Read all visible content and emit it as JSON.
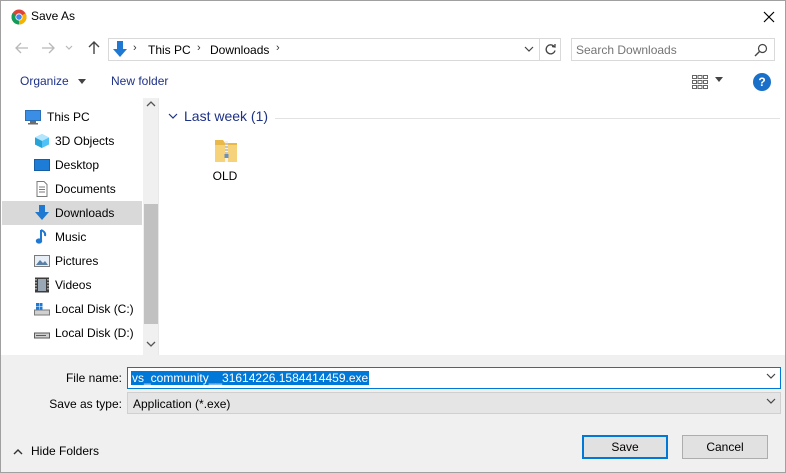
{
  "window": {
    "title": "Save As"
  },
  "address": {
    "crumbs": [
      "This PC",
      "Downloads"
    ],
    "search_placeholder": "Search Downloads"
  },
  "toolbar": {
    "organize_label": "Organize",
    "new_folder_label": "New folder",
    "help_label": "?"
  },
  "nav": {
    "items": [
      {
        "label": "This PC",
        "icon": "pc-icon"
      },
      {
        "label": "3D Objects",
        "icon": "3d-objects-icon"
      },
      {
        "label": "Desktop",
        "icon": "desktop-icon"
      },
      {
        "label": "Documents",
        "icon": "documents-icon"
      },
      {
        "label": "Downloads",
        "icon": "downloads-icon",
        "selected": true
      },
      {
        "label": "Music",
        "icon": "music-icon"
      },
      {
        "label": "Pictures",
        "icon": "pictures-icon"
      },
      {
        "label": "Videos",
        "icon": "videos-icon"
      },
      {
        "label": "Local Disk (C:)",
        "icon": "disk-c-icon"
      },
      {
        "label": "Local Disk (D:)",
        "icon": "disk-d-icon"
      }
    ]
  },
  "content": {
    "group_title": "Last week (1)",
    "files": [
      {
        "name": "OLD",
        "type": "folder"
      }
    ]
  },
  "form": {
    "file_name_label": "File name:",
    "file_name_value": "vs_community__31614226.1584414459.exe",
    "save_type_label": "Save as type:",
    "save_type_value": "Application (*.exe)"
  },
  "footer": {
    "hide_folders_label": "Hide Folders",
    "save_label": "Save",
    "cancel_label": "Cancel"
  },
  "colors": {
    "accent": "#0078d7",
    "link_blue": "#1e3287",
    "selected_nav": "#d9d9d9",
    "bottom_bg": "#f0f0f0"
  }
}
